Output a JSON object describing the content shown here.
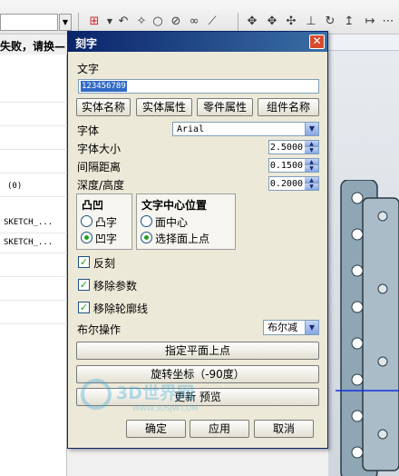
{
  "background": {
    "warning_text": "失败，请换—",
    "left_rows": [
      "(0)",
      "SKETCH_...",
      "SKETCH_..."
    ]
  },
  "dialog": {
    "title": "刻字",
    "close_glyph": "✕",
    "text_label": "文字",
    "text_value": "123456789",
    "tag_buttons": [
      "实体名称",
      "实体属性",
      "零件属性",
      "组件名称"
    ],
    "font_label": "字体",
    "font_value": "Arial",
    "font_size_label": "字体大小",
    "font_size_value": "2.5000",
    "spacing_label": "间隔距离",
    "spacing_value": "0.1500",
    "depth_label": "深度/高度",
    "depth_value": "0.2000",
    "emboss_group": {
      "title": "凸凹",
      "options": [
        "凸字",
        "凹字"
      ],
      "selected": "凹字"
    },
    "center_group": {
      "title": "文字中心位置",
      "options": [
        "面中心",
        "选择面上点"
      ],
      "selected": "选择面上点"
    },
    "checks": [
      {
        "label": "反刻",
        "checked": true
      },
      {
        "label": "移除参数",
        "checked": true
      },
      {
        "label": "移除轮廓线",
        "checked": true
      }
    ],
    "bool_label": "布尔操作",
    "bool_value": "布尔减",
    "specify_plane_button": "指定平面上点",
    "rotate_button": "旋转坐标（-90度）",
    "preview_button": "更新 预览",
    "ok_button": "确定",
    "apply_button": "应用",
    "cancel_button": "取消"
  },
  "watermark": {
    "brand": "3D世界网",
    "url": "WWW.3DSJW.COM"
  },
  "colors": {
    "title_bar": "#0a246a",
    "close_button": "#d84a2e",
    "selection": "#316ac5",
    "check_mark": "#21a121",
    "dialog_face": "#ece9d8"
  }
}
